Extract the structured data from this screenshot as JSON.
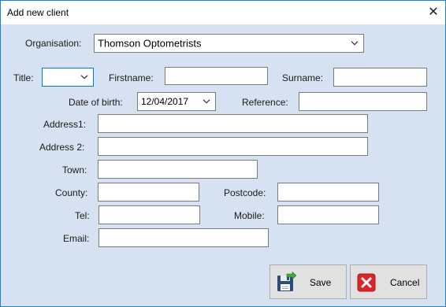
{
  "window": {
    "title": "Add new client",
    "close_glyph": "✕"
  },
  "form": {
    "organisation": {
      "label": "Organisation:",
      "value": "Thomson Optometrists"
    },
    "title": {
      "label": "Title:",
      "value": ""
    },
    "firstname": {
      "label": "Firstname:",
      "value": ""
    },
    "surname": {
      "label": "Surname:",
      "value": ""
    },
    "dob": {
      "label": "Date of birth:",
      "value": "12/04/2017"
    },
    "reference": {
      "label": "Reference:",
      "value": ""
    },
    "address1": {
      "label": "Address1:",
      "value": ""
    },
    "address2": {
      "label": "Address 2:",
      "value": ""
    },
    "town": {
      "label": "Town:",
      "value": ""
    },
    "county": {
      "label": "County:",
      "value": ""
    },
    "postcode": {
      "label": "Postcode:",
      "value": ""
    },
    "tel": {
      "label": "Tel:",
      "value": ""
    },
    "mobile": {
      "label": "Mobile:",
      "value": ""
    },
    "email": {
      "label": "Email:",
      "value": ""
    }
  },
  "buttons": {
    "save": {
      "label": "Save",
      "icon": "save-floppy-icon"
    },
    "cancel": {
      "label": "Cancel",
      "icon": "cancel-x-icon"
    }
  },
  "colors": {
    "background": "#d6e2f1",
    "window_border": "#1883d7",
    "focus_border": "#0078d7",
    "cancel_red": "#d9262b"
  }
}
